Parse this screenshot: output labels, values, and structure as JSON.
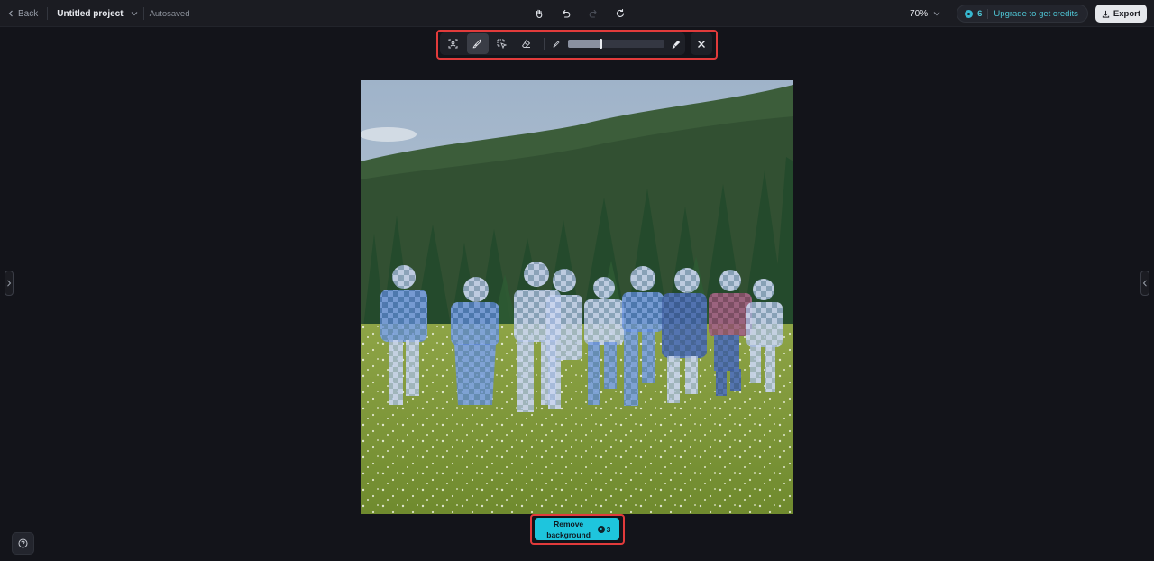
{
  "header": {
    "back_label": "Back",
    "project_name": "Untitled project",
    "save_status": "Autosaved",
    "zoom_level": "70%",
    "credits": "6",
    "upgrade_label": "Upgrade to get credits",
    "export_label": "Export"
  },
  "history_icons": [
    "hand-icon",
    "undo-icon",
    "redo-icon",
    "refresh-icon"
  ],
  "toolbar": {
    "tools": [
      "auto-select-icon",
      "brush-icon",
      "box-select-icon",
      "eraser-icon"
    ],
    "active_tool": "brush-icon",
    "brush_size_fraction": 0.34
  },
  "remove_background": {
    "label": "Remove background",
    "cost": "3"
  },
  "colors": {
    "accent": "#1ec5dd",
    "credit_text": "#4fc6d6",
    "highlight": "#e23b3b",
    "background": "#13141a"
  }
}
